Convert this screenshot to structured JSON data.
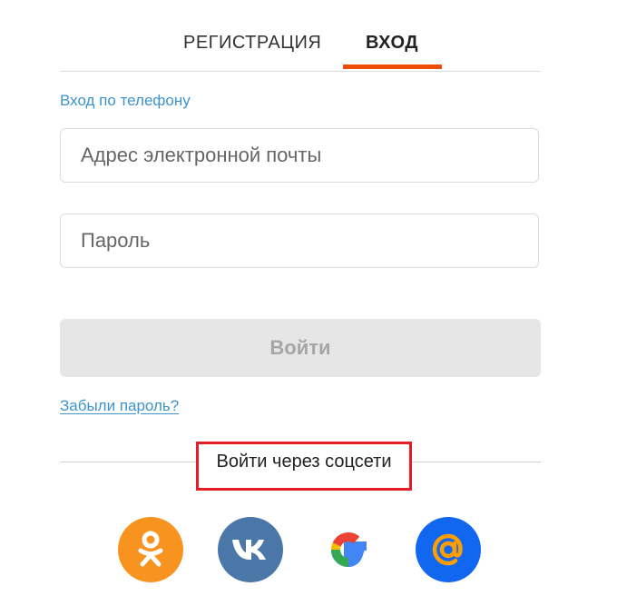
{
  "tabs": [
    {
      "label": "РЕГИСТРАЦИЯ",
      "active": false
    },
    {
      "label": "ВХОД",
      "active": true
    }
  ],
  "accent_color": "#ee4d08",
  "link_color": "#3d94cc",
  "phone_login_link": "Вход по телефону",
  "email_field": {
    "placeholder": "Адрес электронной почты",
    "value": ""
  },
  "password_field": {
    "placeholder": "Пароль",
    "value": ""
  },
  "submit_button": {
    "label": "Войти",
    "disabled": true
  },
  "forgot_password_link": "Забыли пароль?",
  "social": {
    "label": "Войти через соцсети",
    "highlight_color": "#e31e24",
    "providers": [
      {
        "name": "odnoklassniki",
        "icon": "odnoklassniki-icon",
        "color": "#f7931e"
      },
      {
        "name": "vkontakte",
        "icon": "vk-icon",
        "color": "#4a76a8"
      },
      {
        "name": "google",
        "icon": "google-icon",
        "color": "#ffffff"
      },
      {
        "name": "mail.ru",
        "icon": "mail-ru-icon",
        "color": "#1267f0"
      }
    ]
  }
}
